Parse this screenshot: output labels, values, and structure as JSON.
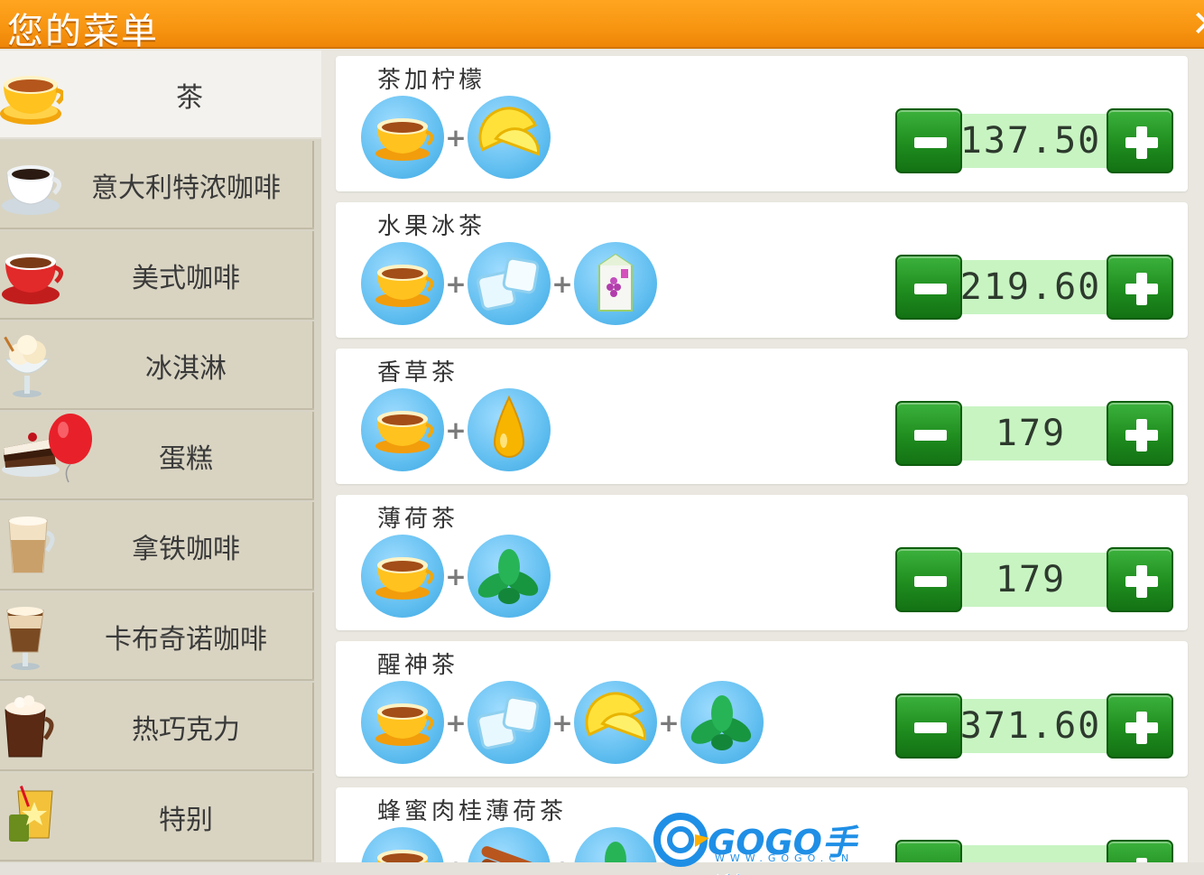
{
  "header": {
    "title": "您的菜单",
    "close_icon": "close-icon"
  },
  "sidebar": {
    "items": [
      {
        "label": "茶",
        "icon": "tea-cup-icon",
        "active": true
      },
      {
        "label": "意大利特浓咖啡",
        "icon": "espresso-cup-icon",
        "active": false
      },
      {
        "label": "美式咖啡",
        "icon": "red-coffee-cup-icon",
        "active": false
      },
      {
        "label": "冰淇淋",
        "icon": "ice-cream-icon",
        "active": false
      },
      {
        "label": "蛋糕",
        "icon": "cake-balloon-icon",
        "active": false
      },
      {
        "label": "拿铁咖啡",
        "icon": "latte-glass-icon",
        "active": false
      },
      {
        "label": "卡布奇诺咖啡",
        "icon": "cappuccino-glass-icon",
        "active": false
      },
      {
        "label": "热巧克力",
        "icon": "hot-chocolate-icon",
        "active": false
      },
      {
        "label": "特别",
        "icon": "special-drink-icon",
        "active": false
      }
    ]
  },
  "menu": [
    {
      "name": "茶加柠檬",
      "ingredients": [
        "tea-icon",
        "lemon-icon"
      ],
      "price": "137.50"
    },
    {
      "name": "水果冰茶",
      "ingredients": [
        "tea-icon",
        "ice-cube-icon",
        "grape-juice-icon"
      ],
      "price": "219.60"
    },
    {
      "name": "香草茶",
      "ingredients": [
        "tea-icon",
        "oil-drop-icon"
      ],
      "price": "179"
    },
    {
      "name": "薄荷茶",
      "ingredients": [
        "tea-icon",
        "mint-icon"
      ],
      "price": "179"
    },
    {
      "name": "醒神茶",
      "ingredients": [
        "tea-icon",
        "ice-cube-icon",
        "lemon-icon",
        "mint-icon"
      ],
      "price": "371.60"
    },
    {
      "name": "蜂蜜肉桂薄荷茶",
      "ingredients": [
        "tea-icon",
        "cinnamon-icon",
        "mint-icon"
      ],
      "price": ""
    }
  ],
  "watermark": {
    "text": "GOGO手游网",
    "sub": "WWW.GOGO.CN"
  }
}
